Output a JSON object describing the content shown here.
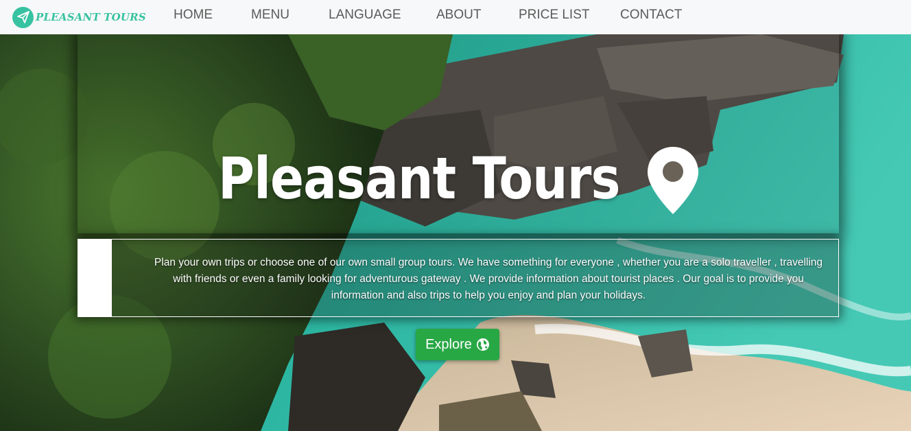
{
  "navbar": {
    "brand": "PLEASANT TOURS",
    "brand_icon": "paper-plane-icon",
    "links": [
      "HOME",
      "MENU",
      "LANGUAGE",
      "ABOUT",
      "PRICE LIST",
      "CONTACT"
    ]
  },
  "hero": {
    "title": "Pleasant Tours",
    "title_icon": "map-pin-icon",
    "description": "Plan your own trips or choose one of our own small group tours. We have something for everyone , whether you are a solo traveller , travelling with friends or even a family looking for adventurous gateway . We provide information about tourist places . Our goal is to provide you information and also trips to help you enjoy and plan your holidays.",
    "button_label": "Explore",
    "button_icon": "globe-icon"
  },
  "colors": {
    "brand": "#37c2a1",
    "button": "#28a745",
    "navbar_bg": "#f7f8f9",
    "nav_text": "#5a5a5a"
  }
}
